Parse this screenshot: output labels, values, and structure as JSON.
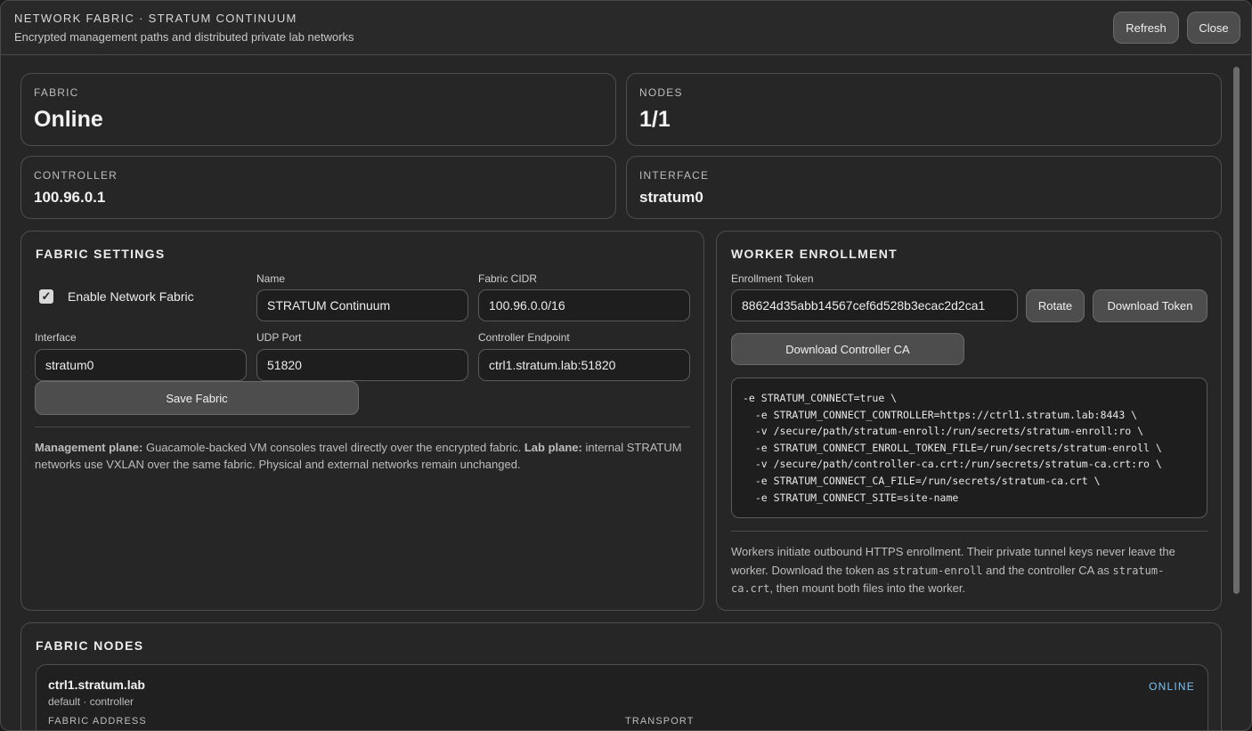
{
  "header": {
    "title": "NETWORK FABRIC · STRATUM CONTINUUM",
    "subtitle": "Encrypted management paths and distributed private lab networks",
    "refresh_label": "Refresh",
    "close_label": "Close"
  },
  "stats": {
    "fabric": {
      "label": "FABRIC",
      "value": "Online"
    },
    "nodes": {
      "label": "NODES",
      "value": "1/1"
    },
    "controller": {
      "label": "CONTROLLER",
      "value": "100.96.0.1"
    },
    "interface": {
      "label": "INTERFACE",
      "value": "stratum0"
    }
  },
  "fabric_settings": {
    "title": "FABRIC SETTINGS",
    "enable_label": "Enable Network Fabric",
    "enable_checked": true,
    "name_label": "Name",
    "name_value": "STRATUM Continuum",
    "cidr_label": "Fabric CIDR",
    "cidr_value": "100.96.0.0/16",
    "interface_label": "Interface",
    "interface_value": "stratum0",
    "udp_label": "UDP Port",
    "udp_value": "51820",
    "endpoint_label": "Controller Endpoint",
    "endpoint_value": "ctrl1.stratum.lab:51820",
    "save_label": "Save Fabric",
    "note": {
      "mgmt_title": "Management plane:",
      "mgmt_text": " Guacamole-backed VM consoles travel directly over the encrypted fabric. ",
      "lab_title": "Lab plane:",
      "lab_text": " internal STRATUM networks use VXLAN over the same fabric. Physical and external networks remain unchanged."
    }
  },
  "worker_enrollment": {
    "title": "WORKER ENROLLMENT",
    "token_label": "Enrollment Token",
    "token_value": "88624d35abb14567cef6d528b3ecac2d2ca1",
    "rotate_label": "Rotate",
    "download_token_label": "Download Token",
    "download_ca_label": "Download Controller CA",
    "command": "-e STRATUM_CONNECT=true \\\n  -e STRATUM_CONNECT_CONTROLLER=https://ctrl1.stratum.lab:8443 \\\n  -v /secure/path/stratum-enroll:/run/secrets/stratum-enroll:ro \\\n  -e STRATUM_CONNECT_ENROLL_TOKEN_FILE=/run/secrets/stratum-enroll \\\n  -v /secure/path/controller-ca.crt:/run/secrets/stratum-ca.crt:ro \\\n  -e STRATUM_CONNECT_CA_FILE=/run/secrets/stratum-ca.crt \\\n  -e STRATUM_CONNECT_SITE=site-name",
    "note": {
      "part1": "Workers initiate outbound HTTPS enrollment. Their private tunnel keys never leave the worker. Download the token as ",
      "code1": "stratum-enroll",
      "part2": " and the controller CA as ",
      "code2": "stratum-ca.crt",
      "part3": ", then mount both files into the worker."
    }
  },
  "fabric_nodes": {
    "title": "FABRIC NODES",
    "nodes": [
      {
        "name": "ctrl1.stratum.lab",
        "meta": "default · controller",
        "status": "ONLINE",
        "col1_label": "FABRIC ADDRESS",
        "col2_label": "TRANSPORT"
      }
    ]
  },
  "colors": {
    "online_status": "#7cc4f5",
    "background": "#262626"
  }
}
